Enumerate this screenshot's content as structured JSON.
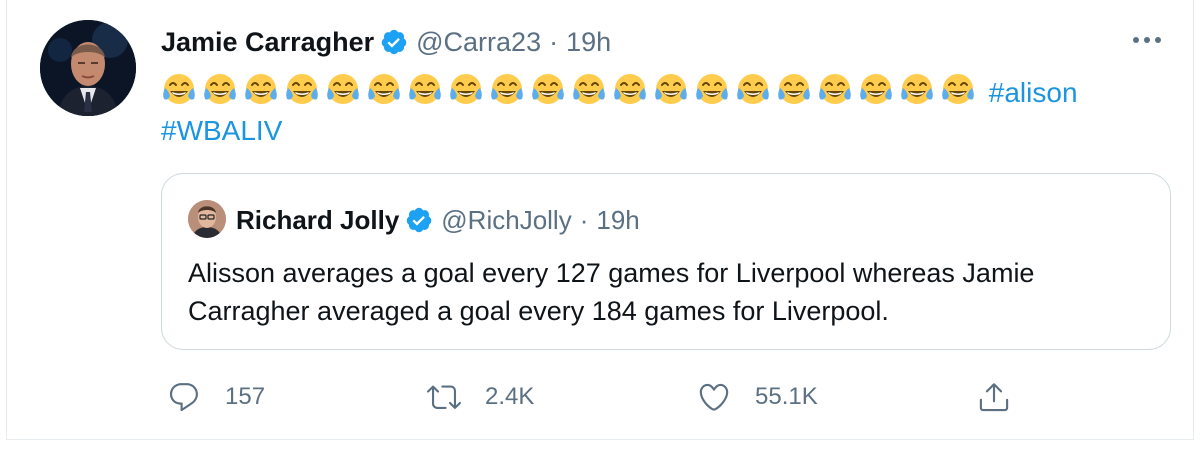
{
  "tweet": {
    "author_name": "Jamie Carragher",
    "handle": "@Carra23",
    "separator": "·",
    "time": "19h",
    "emoji_count": 20,
    "hashtag1": "#alison",
    "hashtag2": "#WBALIV"
  },
  "quoted": {
    "author_name": "Richard Jolly",
    "handle": "@RichJolly",
    "separator": "·",
    "time": "19h",
    "text": "Alisson averages a goal every 127 games for Liverpool whereas Jamie Carragher averaged a goal every 184 games for Liverpool."
  },
  "actions": {
    "replies": "157",
    "retweets": "2.4K",
    "likes": "55.1K"
  },
  "colors": {
    "accent": "#1b95e0",
    "verified": "#1da1f2",
    "secondary_text": "#5b7083"
  }
}
